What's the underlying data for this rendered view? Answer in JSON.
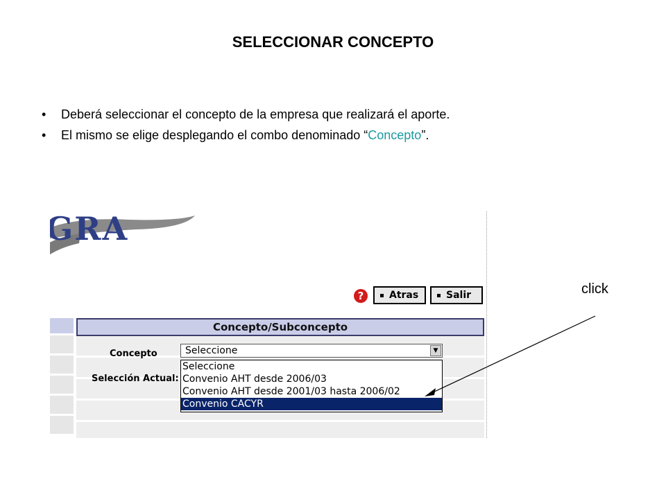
{
  "slide": {
    "title": "SELECCIONAR CONCEPTO",
    "bullets": [
      {
        "text": "Deberá seleccionar el concepto de la empresa que realizará el aporte."
      },
      {
        "prefix": "El mismo se elige desplegando el combo denominado “",
        "highlight": "Concepto",
        "suffix": "”."
      }
    ],
    "bullet_glyph": "•",
    "click_label": "click"
  },
  "app": {
    "logo_text": "GRA",
    "help_icon": "question-mark-icon",
    "buttons": {
      "atras": "Atras",
      "salir": "Salir"
    },
    "panel": {
      "title": "Concepto/Subconcepto",
      "concepto_label": "Concepto",
      "seleccion_label": "Selección Actual:",
      "select_value": "Seleccione",
      "arrow_glyph": "▼",
      "options": [
        "Seleccione",
        "Convenio AHT desde 2006/03",
        "Convenio AHT desde 2001/03 hasta 2006/02",
        "Convenio CACYR"
      ],
      "selected_index": 3
    }
  },
  "colors": {
    "highlight": "#1a9aa0",
    "header_bg": "#c9cde8",
    "selected_bg": "#0a246a",
    "help_red": "#d21b1b"
  }
}
